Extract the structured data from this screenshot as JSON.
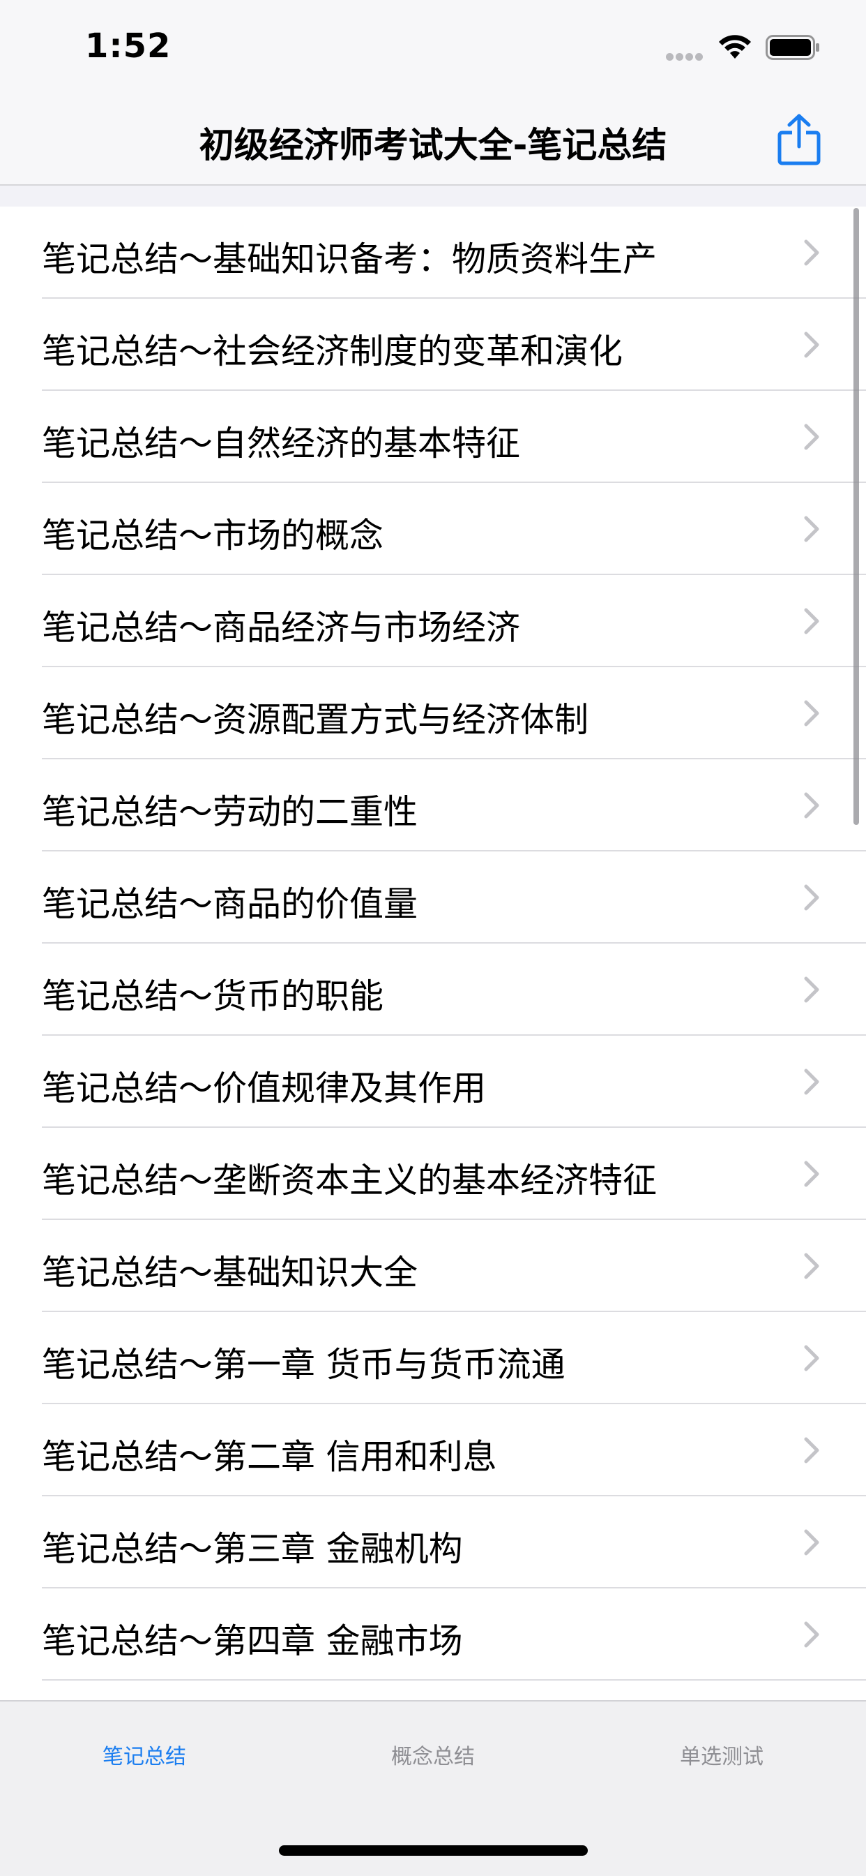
{
  "status_bar": {
    "time": "1:52"
  },
  "nav": {
    "title": "初级经济师考试大全-笔记总结",
    "share_icon": "share-icon",
    "accent_color": "#1a7df0"
  },
  "list": {
    "items": [
      {
        "label": "笔记总结～基础知识备考：物质资料生产"
      },
      {
        "label": "笔记总结～社会经济制度的变革和演化"
      },
      {
        "label": "笔记总结～自然经济的基本特征"
      },
      {
        "label": "笔记总结～市场的概念"
      },
      {
        "label": "笔记总结～商品经济与市场经济"
      },
      {
        "label": "笔记总结～资源配置方式与经济体制"
      },
      {
        "label": "笔记总结～劳动的二重性"
      },
      {
        "label": "笔记总结～商品的价值量"
      },
      {
        "label": "笔记总结～货币的职能"
      },
      {
        "label": "笔记总结～价值规律及其作用"
      },
      {
        "label": "笔记总结～垄断资本主义的基本经济特征"
      },
      {
        "label": "笔记总结～基础知识大全"
      },
      {
        "label": "笔记总结～第一章 货币与货币流通"
      },
      {
        "label": "笔记总结～第二章 信用和利息"
      },
      {
        "label": "笔记总结～第三章 金融机构"
      },
      {
        "label": "笔记总结～第四章 金融市场"
      },
      {
        "label": ""
      }
    ]
  },
  "tab_bar": {
    "tabs": [
      {
        "label": "笔记总结",
        "active": true
      },
      {
        "label": "概念总结",
        "active": false
      },
      {
        "label": "单选测试",
        "active": false
      }
    ]
  }
}
